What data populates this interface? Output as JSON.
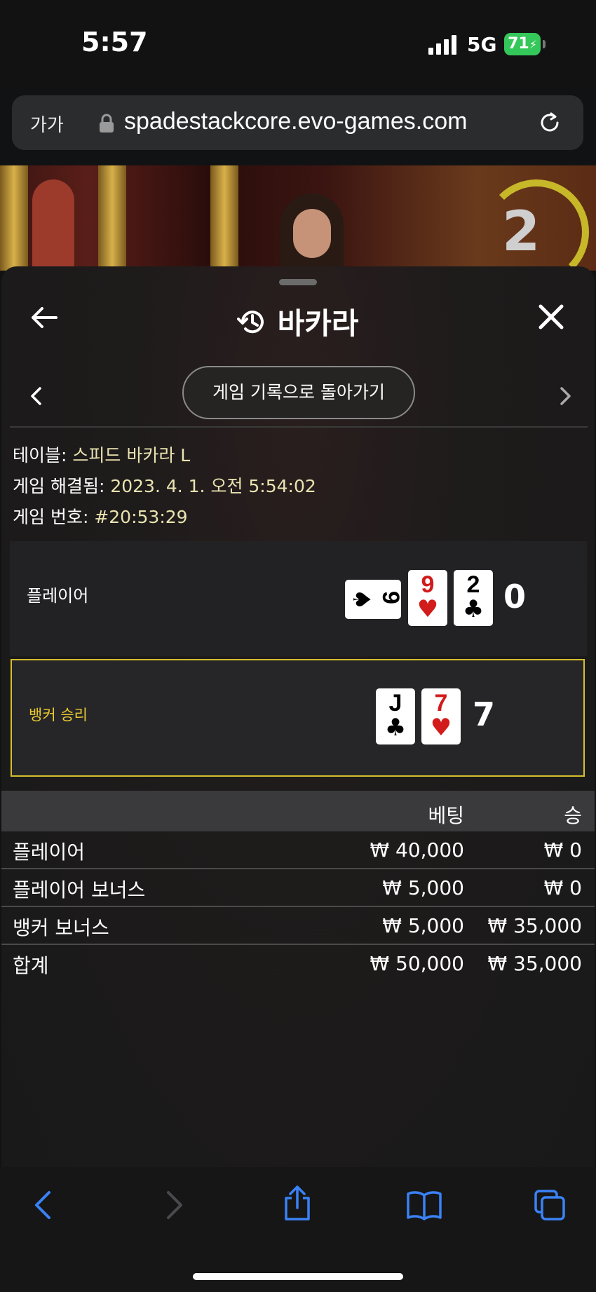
{
  "status": {
    "time": "5:57",
    "network": "5G",
    "battery": "71"
  },
  "browser": {
    "text_size": "가가",
    "url": "spadestackcore.evo-games.com"
  },
  "video": {
    "countdown": "2"
  },
  "panel": {
    "title": "바카라",
    "back_pill": "게임 기록으로 돌아가기",
    "info": {
      "table_label": "테이블: ",
      "table_value": "스피드 바카라 L",
      "resolved_label": "게임 해결됨: ",
      "resolved_value": "2023. 4. 1. 오전 5:54:02",
      "number_label": "게임 번호: ",
      "number_value": "#20:53:29"
    },
    "player": {
      "label": "플레이어",
      "cards": [
        {
          "rank": "9",
          "suit": "♠",
          "color": "#000000"
        },
        {
          "rank": "9",
          "suit": "♥",
          "color": "#d21b1b"
        },
        {
          "rank": "2",
          "suit": "♣",
          "color": "#000000"
        }
      ],
      "score": "0"
    },
    "banker": {
      "label": "뱅커 승리",
      "label_color": "#e8c830",
      "cards": [
        {
          "rank": "J",
          "suit": "♣",
          "color": "#000000"
        },
        {
          "rank": "7",
          "suit": "♥",
          "color": "#d21b1b"
        }
      ],
      "score": "7"
    },
    "bets": {
      "headers": {
        "bet": "베팅",
        "win": "승"
      },
      "rows": [
        {
          "label": "플레이어",
          "bet": "₩ 40,000",
          "win": "₩ 0"
        },
        {
          "label": "플레이어 보너스",
          "bet": "₩ 5,000",
          "win": "₩ 0"
        },
        {
          "label": "뱅커 보너스",
          "bet": "₩ 5,000",
          "win": "₩ 35,000"
        },
        {
          "label": "합계",
          "bet": "₩ 50,000",
          "win": "₩ 35,000"
        }
      ]
    }
  },
  "toolbar": {
    "icons": [
      "back-icon",
      "forward-icon",
      "share-icon",
      "bookmarks-icon",
      "tabs-icon"
    ],
    "accent": "#3a82f7"
  }
}
